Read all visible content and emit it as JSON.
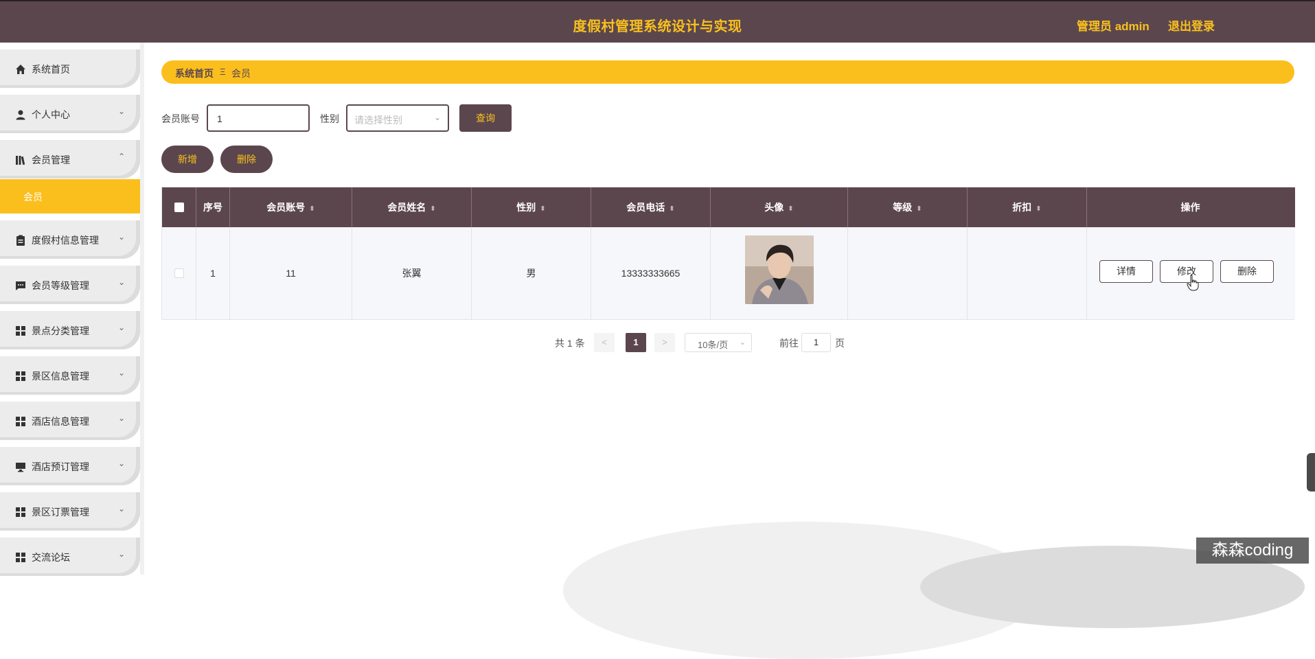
{
  "header": {
    "title": "度假村管理系统设计与实现",
    "user": "管理员 admin",
    "logout": "退出登录"
  },
  "sidebar": {
    "items": [
      {
        "label": "系统首页",
        "icon": "home-icon",
        "arrow": ""
      },
      {
        "label": "个人中心",
        "icon": "user-icon",
        "arrow": "⌄"
      },
      {
        "label": "会员管理",
        "icon": "book-icon",
        "arrow": "⌃"
      },
      {
        "label": "度假村信息管理",
        "icon": "clipboard-icon",
        "arrow": "⌄"
      },
      {
        "label": "会员等级管理",
        "icon": "chat-icon",
        "arrow": "⌄"
      },
      {
        "label": "景点分类管理",
        "icon": "grid-icon",
        "arrow": "⌄"
      },
      {
        "label": "景区信息管理",
        "icon": "grid-icon",
        "arrow": "⌄"
      },
      {
        "label": "酒店信息管理",
        "icon": "grid-icon",
        "arrow": "⌄"
      },
      {
        "label": "酒店预订管理",
        "icon": "monitor-icon",
        "arrow": "⌄"
      },
      {
        "label": "景区订票管理",
        "icon": "grid-icon",
        "arrow": "⌄"
      },
      {
        "label": "交流论坛",
        "icon": "grid-icon",
        "arrow": "⌄"
      }
    ],
    "sub_item": "会员"
  },
  "breadcrumb": {
    "home": "系统首页",
    "separator": "Ξ",
    "current": "会员"
  },
  "search": {
    "account_label": "会员账号",
    "account_value": "1",
    "gender_label": "性别",
    "gender_placeholder": "请选择性别",
    "query_button": "查询"
  },
  "actions": {
    "add": "新增",
    "delete": "删除"
  },
  "table": {
    "headers": [
      "序号",
      "会员账号",
      "会员姓名",
      "性别",
      "会员电话",
      "头像",
      "等级",
      "折扣",
      "操作"
    ],
    "rows": [
      {
        "index": "1",
        "account": "11",
        "name": "张翼",
        "gender": "男",
        "phone": "13333333665",
        "level": "",
        "discount": ""
      }
    ],
    "row_buttons": {
      "detail": "详情",
      "edit": "修改",
      "delete": "删除"
    }
  },
  "pagination": {
    "total": "共 1 条",
    "prev": "<",
    "current_page": "1",
    "next": ">",
    "page_size": "10条/页",
    "goto_label": "前往",
    "goto_value": "1",
    "page_suffix": "页"
  },
  "watermark": "森森coding",
  "colors": {
    "primary": "#5c464e",
    "accent": "#fbbf1d",
    "header_text": "#f9c11d"
  }
}
